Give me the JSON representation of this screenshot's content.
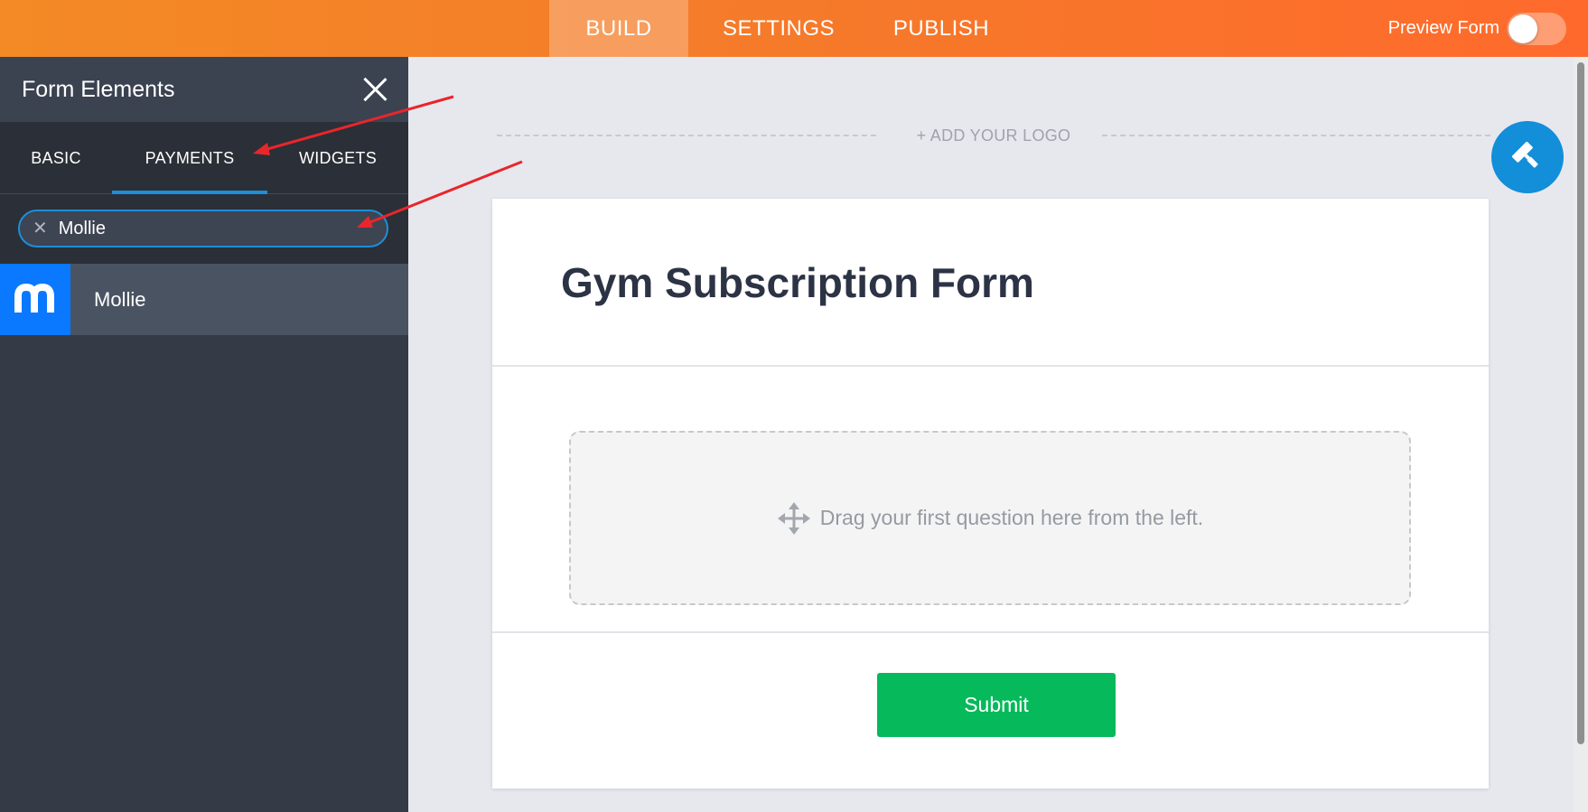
{
  "topbar": {
    "tabs": [
      {
        "label": "BUILD"
      },
      {
        "label": "SETTINGS"
      },
      {
        "label": "PUBLISH"
      }
    ],
    "preview_label": "Preview Form",
    "preview_enabled": false
  },
  "sidebar": {
    "title": "Form Elements",
    "tabs": [
      {
        "label": "BASIC"
      },
      {
        "label": "PAYMENTS",
        "active": true
      },
      {
        "label": "WIDGETS"
      }
    ],
    "search": {
      "value": "Mollie",
      "clear_icon": "close-icon"
    },
    "results": [
      {
        "label": "Mollie",
        "icon": "mollie-logo"
      }
    ]
  },
  "canvas": {
    "add_logo": "+ ADD YOUR LOGO",
    "form": {
      "title": "Gym Subscription Form",
      "dropzone_text": "Drag your first question here from the left.",
      "submit_label": "Submit"
    }
  },
  "colors": {
    "accent": "#1d8ed9",
    "topbar_start": "#f38a25",
    "topbar_end": "#ff6a2c",
    "submit": "#06b95a",
    "mollie": "#0a78ff",
    "annotation": "#e8262b"
  }
}
